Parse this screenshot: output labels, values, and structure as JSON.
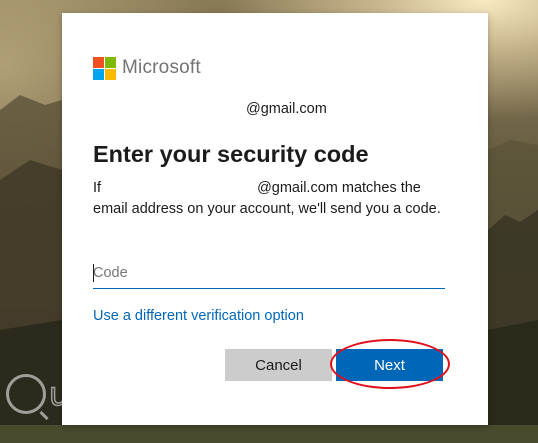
{
  "brand": {
    "name": "Microsoft",
    "logo_colors": [
      "#f25022",
      "#7fba00",
      "#00a4ef",
      "#ffb900"
    ]
  },
  "account": {
    "email_display": "@gmail.com"
  },
  "heading": "Enter your security code",
  "description": {
    "prefix": "If",
    "email": "@gmail.com",
    "rest": "matches the email address on your account, we'll send you a code."
  },
  "code_field": {
    "placeholder": "Code",
    "value": ""
  },
  "alt_option_link": "Use a different verification option",
  "buttons": {
    "cancel": "Cancel",
    "next": "Next"
  },
  "watermark": {
    "text": "uantrimang"
  },
  "colors": {
    "accent": "#0067b8",
    "highlight_ring": "#e0101a",
    "cancel_bg": "#cccccc"
  }
}
